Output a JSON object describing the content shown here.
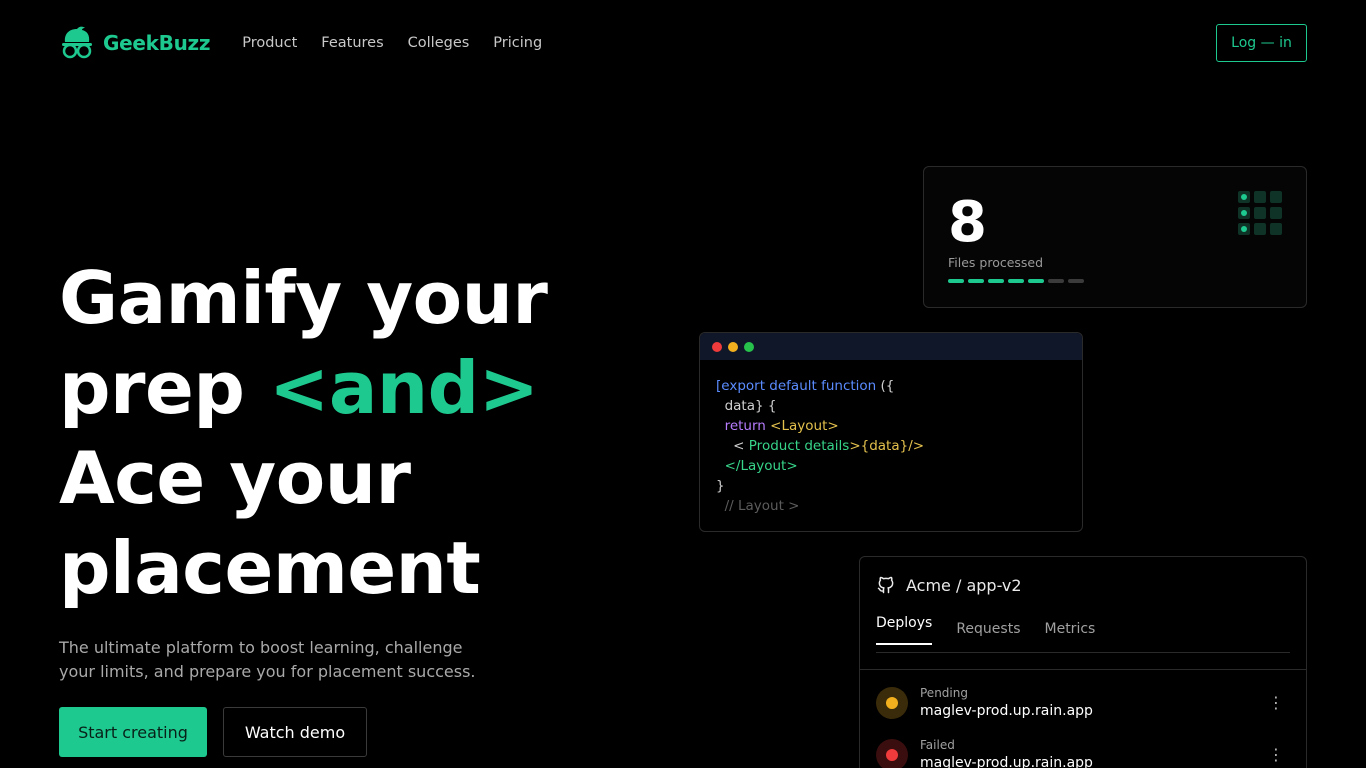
{
  "brand": {
    "name": "GeekBuzz",
    "accent": "#1ec98f"
  },
  "nav": {
    "links": [
      "Product",
      "Features",
      "Colleges",
      "Pricing"
    ],
    "login_label": "Log — in"
  },
  "hero": {
    "line1": "Gamify your",
    "line2_start": "prep ",
    "line2_accent": "<and>",
    "line3": "Ace your",
    "line4": "placement",
    "subtitle": "The ultimate platform to boost learning, challenge your limits, and prepare you for placement success.",
    "primary_cta": "Start creating",
    "secondary_cta": "Watch demo"
  },
  "stats": {
    "value": "8",
    "label": "Files processed",
    "progress_filled": 5,
    "progress_total": 7
  },
  "code": {
    "lines": {
      "l1a": "[export default function ",
      "l1b": "({",
      "l2": "  data} {",
      "l3a": "  return ",
      "l3b": "<Layout>",
      "l4a": "    < ",
      "l4b": "Product details",
      "l4c": ">{data}/>",
      "l5": "  </Layout>",
      "l6": "}",
      "l7": "  // Layout >"
    }
  },
  "repo": {
    "title": "Acme / app-v2",
    "tabs": [
      "Deploys",
      "Requests",
      "Metrics"
    ],
    "deploys": [
      {
        "status": "Pending",
        "host": "maglev-prod.up.rain.app",
        "color": "#f2b01e"
      },
      {
        "status": "Failed",
        "host": "maglev-prod.up.rain.app",
        "color": "#ef3b3b"
      }
    ]
  }
}
